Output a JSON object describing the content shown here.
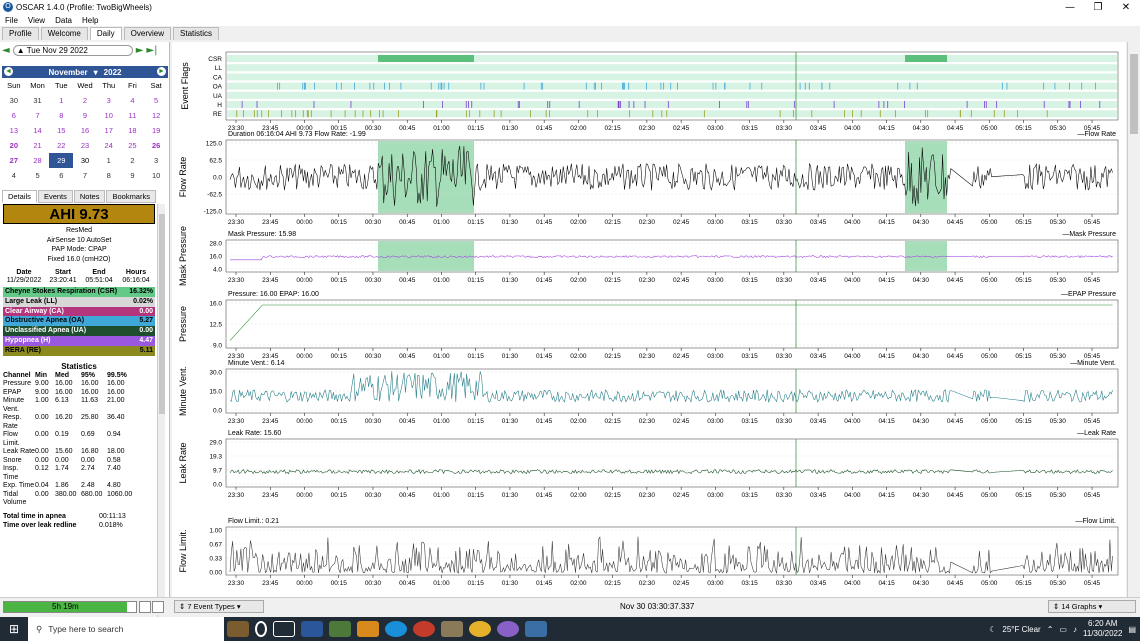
{
  "window": {
    "title": "OSCAR 1.4.0 (Profile: TwoBigWheels)",
    "app_icon": "oscar-icon",
    "controls": [
      "minimize-icon",
      "restore-icon",
      "close-icon"
    ]
  },
  "menu": [
    "File",
    "View",
    "Data",
    "Help"
  ],
  "tabs": [
    {
      "label": "Profile"
    },
    {
      "label": "Welcome"
    },
    {
      "label": "Daily",
      "active": true
    },
    {
      "label": "Overview"
    },
    {
      "label": "Statistics"
    }
  ],
  "date_nav": {
    "date": "Tue Nov 29 2022",
    "prev": "◄",
    "next": "►",
    "last": "►|"
  },
  "calendar": {
    "month": "November",
    "year": "2022",
    "dow": [
      "Sun",
      "Mon",
      "Tue",
      "Wed",
      "Thu",
      "Fri",
      "Sat"
    ],
    "weeks": [
      [
        "30",
        "31",
        "1",
        "2",
        "3",
        "4",
        "5"
      ],
      [
        "6",
        "7",
        "8",
        "9",
        "10",
        "11",
        "12"
      ],
      [
        "13",
        "14",
        "15",
        "16",
        "17",
        "18",
        "19"
      ],
      [
        "20",
        "21",
        "22",
        "23",
        "24",
        "25",
        "26"
      ],
      [
        "27",
        "28",
        "29",
        "30",
        "1",
        "2",
        "3"
      ],
      [
        "4",
        "5",
        "6",
        "7",
        "8",
        "9",
        "10"
      ]
    ],
    "selected": "29",
    "accent": "#2f5596",
    "session_color": "#9b2fc4"
  },
  "left_tabs": [
    "Details",
    "Events",
    "Notes",
    "Bookmarks"
  ],
  "ahi": {
    "label": "AHI 9.73",
    "bg": "#b3860f"
  },
  "machine": [
    "ResMed",
    "AirSense 10 AutoSet",
    "PAP Mode: CPAP",
    "Fixed 16.0 (cmH2O)"
  ],
  "session": {
    "headers": [
      "Date",
      "Start",
      "End",
      "Hours"
    ],
    "values": [
      "11/29/2022",
      "23:20:41",
      "05:51:04",
      "06:16:04"
    ]
  },
  "events": [
    {
      "name": "Cheyne Stokes Respiration (CSR)",
      "value": "16.32%",
      "bg": "#62c986",
      "fg": "#000"
    },
    {
      "name": "Large Leak (LL)",
      "value": "0.02%",
      "bg": "#d8d8d8",
      "fg": "#000"
    },
    {
      "name": "Clear Airway (CA)",
      "value": "0.00",
      "bg": "#b3357c",
      "fg": "#fff"
    },
    {
      "name": "Obstructive Apnea (OA)",
      "value": "5.27",
      "bg": "#40a8d8",
      "fg": "#000"
    },
    {
      "name": "Unclassified Apnea (UA)",
      "value": "0.00",
      "bg": "#1f4e2e",
      "fg": "#fff"
    },
    {
      "name": "Hypopnea (H)",
      "value": "4.47",
      "bg": "#9a57e0",
      "fg": "#fff"
    },
    {
      "name": "RERA (RE)",
      "value": "5.11",
      "bg": "#8a8a1e",
      "fg": "#000"
    }
  ],
  "stats": {
    "title": "Statistics",
    "headers": [
      "Channel",
      "Min",
      "Med",
      "95%",
      "99.5%"
    ],
    "rows": [
      [
        "Pressure",
        "9.00",
        "16.00",
        "16.00",
        "16.00"
      ],
      [
        "EPAP",
        "9.00",
        "16.00",
        "16.00",
        "16.00"
      ],
      [
        "Minute Vent.",
        "1.00",
        "6.13",
        "11.63",
        "21.00"
      ],
      [
        "Resp. Rate",
        "0.00",
        "16.20",
        "25.80",
        "36.40"
      ],
      [
        "Flow Limit.",
        "0.00",
        "0.19",
        "0.69",
        "0.94"
      ],
      [
        "Leak Rate",
        "0.00",
        "15.60",
        "16.80",
        "18.00"
      ],
      [
        "Snore",
        "0.00",
        "0.00",
        "0.00",
        "0.58"
      ],
      [
        "Insp. Time",
        "0.12",
        "1.74",
        "2.74",
        "7.40"
      ],
      [
        "Exp. Time",
        "0.04",
        "1.86",
        "2.48",
        "4.80"
      ],
      [
        "Tidal Volume",
        "0.00",
        "380.00",
        "680.00",
        "1060.00"
      ]
    ]
  },
  "totals": [
    [
      "Total time in apnea",
      "00:11:13"
    ],
    [
      "Time over leak redline",
      "0.018%"
    ]
  ],
  "progress": {
    "label": "5h 19m",
    "fraction": 0.93
  },
  "bottom": {
    "event_types": "7 Event Types",
    "status": "Nov 30 03:30:37.337",
    "graphs": "14 Graphs"
  },
  "time_ticks": [
    "23:30",
    "23:45",
    "00:00",
    "00:15",
    "00:30",
    "00:45",
    "01:00",
    "01:15",
    "01:30",
    "01:45",
    "02:00",
    "02:15",
    "02:30",
    "02:45",
    "03:00",
    "03:15",
    "03:30",
    "03:45",
    "04:00",
    "04:15",
    "04:30",
    "04:45",
    "05:00",
    "05:15",
    "05:30",
    "05:45"
  ],
  "flags_panel": {
    "title": "Event Flags",
    "rows": [
      "CSR",
      "LL",
      "CA",
      "OA",
      "UA",
      "H",
      "RE"
    ]
  },
  "panels": [
    {
      "title": "Flow Rate",
      "info": "Duration 06:16:04 AHI 9.73 Flow Rate: -1.99",
      "legend": "Flow Rate",
      "ticks": [
        "125.0",
        "62.5",
        "0.0",
        "-62.5",
        "-125.0"
      ],
      "color": "#000000"
    },
    {
      "title": "Mask Pressure",
      "info": "Mask Pressure: 15.98",
      "legend": "Mask Pressure",
      "ticks": [
        "28.0",
        "16.0",
        "4.0"
      ],
      "color": "#a040e0"
    },
    {
      "title": "Pressure",
      "info": "Pressure: 16.00 EPAP: 16.00",
      "legend": "EPAP Pressure",
      "ticks": [
        "16.0",
        "12.5",
        "9.0"
      ],
      "color": "#2a8a2a"
    },
    {
      "title": "Minute Vent.",
      "info": "Minute Vent.: 6.14",
      "legend": "Minute Vent.",
      "ticks": [
        "30.0",
        "15.0",
        "0.0"
      ],
      "color": "#1e7a85"
    },
    {
      "title": "Leak Rate",
      "info": "Leak Rate: 15.60",
      "legend": "Leak Rate",
      "ticks": [
        "29.0",
        "19.3",
        "9.7",
        "0.0"
      ],
      "color": "#0d4a1e"
    },
    {
      "title": "Flow Limit.",
      "info": "Flow Limit.: 0.21",
      "legend": "Flow Limit.",
      "ticks": [
        "1.00",
        "0.67",
        "0.33",
        "0.00"
      ],
      "color": "#333333"
    }
  ],
  "taskbar": {
    "search": "Type here to search",
    "weather": "25°F  Clear",
    "time": "6:20 AM",
    "date": "11/30/2022"
  }
}
